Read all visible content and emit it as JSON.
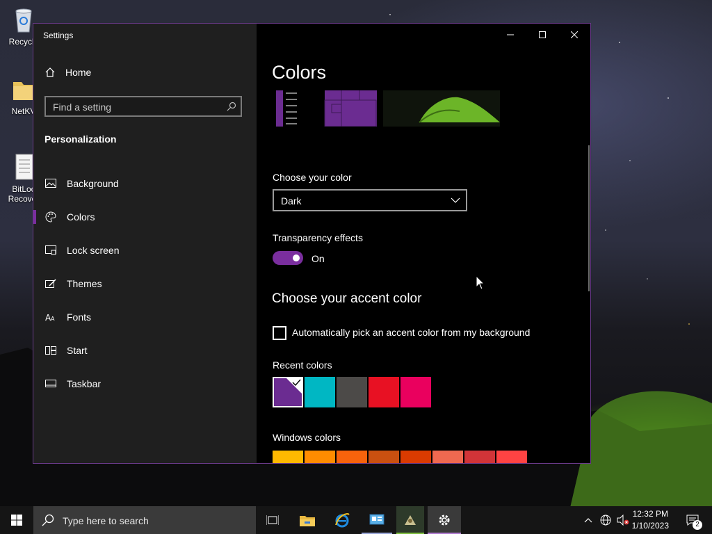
{
  "desktop": {
    "icons": [
      {
        "label": "Recycle",
        "icon": "recycle-bin-icon"
      },
      {
        "label": "NetKV",
        "icon": "folder-icon"
      },
      {
        "label": "BitLoc\nRecover",
        "icon": "document-icon"
      }
    ]
  },
  "window": {
    "title": "Settings",
    "controls": {
      "minimize": "minimize-icon",
      "maximize": "maximize-icon",
      "close": "close-icon"
    }
  },
  "sidebar": {
    "home_label": "Home",
    "search_placeholder": "Find a setting",
    "section_title": "Personalization",
    "items": [
      {
        "label": "Background",
        "icon": "picture-icon",
        "active": false
      },
      {
        "label": "Colors",
        "icon": "palette-icon",
        "active": true
      },
      {
        "label": "Lock screen",
        "icon": "lock-screen-icon",
        "active": false
      },
      {
        "label": "Themes",
        "icon": "brush-icon",
        "active": false
      },
      {
        "label": "Fonts",
        "icon": "font-icon",
        "active": false
      },
      {
        "label": "Start",
        "icon": "start-grid-icon",
        "active": false
      },
      {
        "label": "Taskbar",
        "icon": "taskbar-icon",
        "active": false
      }
    ]
  },
  "main": {
    "title": "Colors",
    "choose_color_label": "Choose your color",
    "choose_color_value": "Dark",
    "transparency_label": "Transparency effects",
    "transparency_state": "On",
    "transparency_on": true,
    "accent_heading": "Choose your accent color",
    "auto_pick_label": "Automatically pick an accent color from my background",
    "auto_pick_checked": false,
    "recent_colors_label": "Recent colors",
    "recent_colors": [
      "#6b2c91",
      "#00b7c3",
      "#4c4a48",
      "#e81123",
      "#ea005e"
    ],
    "selected_recent_index": 0,
    "windows_colors_label": "Windows colors",
    "windows_colors": [
      "#ffb900",
      "#ff8c00",
      "#f7630c",
      "#ca5010",
      "#da3b01",
      "#ef6950",
      "#d13438",
      "#ff4343"
    ],
    "accent_color": "#7a2e9e"
  },
  "taskbar": {
    "search_placeholder": "Type here to search",
    "apps": [
      "task-view-icon",
      "file-explorer-icon",
      "internet-explorer-icon",
      "control-panel-icon",
      "app-icon",
      "settings-gear-icon"
    ],
    "time": "12:32 PM",
    "date": "1/10/2023",
    "notification_count": "2"
  }
}
